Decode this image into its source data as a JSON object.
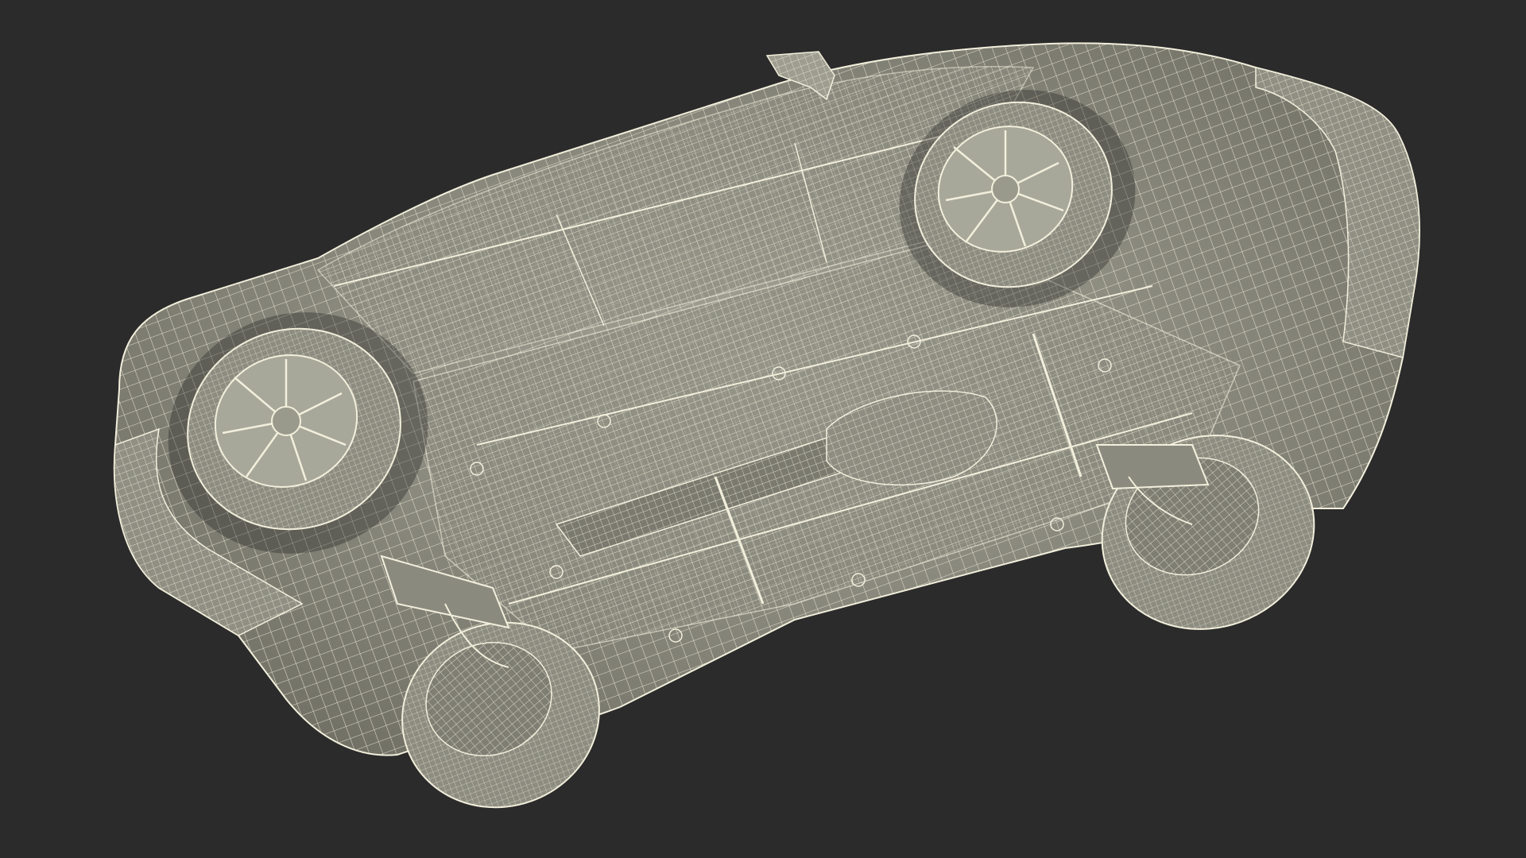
{
  "scene": {
    "subject": "car-underside-wireframe-render",
    "background_color": "#2b2b2b",
    "body_color": "#9a9a8c",
    "body_shadow_color": "#6f6f64",
    "wire_color": "#f2efdc",
    "tire_color": "#8c8c80",
    "hub_color": "#a8a89a"
  }
}
